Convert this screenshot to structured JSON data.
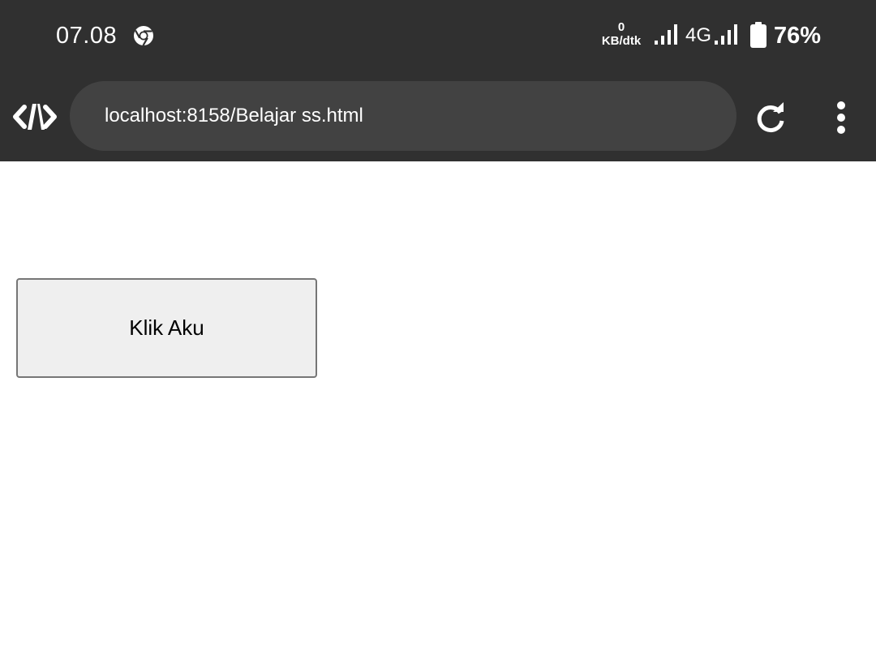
{
  "status_bar": {
    "time": "07.08",
    "net_speed_value": "0",
    "net_speed_unit": "KB/dtk",
    "network_type": "4G",
    "battery_percent": "76%",
    "icons": [
      "chrome-icon",
      "signal-icon",
      "signal-icon",
      "battery-icon"
    ]
  },
  "toolbar": {
    "url": "localhost:8158/Belajar ss.html",
    "icons": [
      "dev-tools-icon",
      "reload-icon",
      "more-menu-icon"
    ]
  },
  "page": {
    "button_label": "Klik Aku"
  },
  "colors": {
    "bar_background": "#303030",
    "url_bar_background": "#424242",
    "button_background": "#efefef",
    "button_border": "#767676"
  }
}
